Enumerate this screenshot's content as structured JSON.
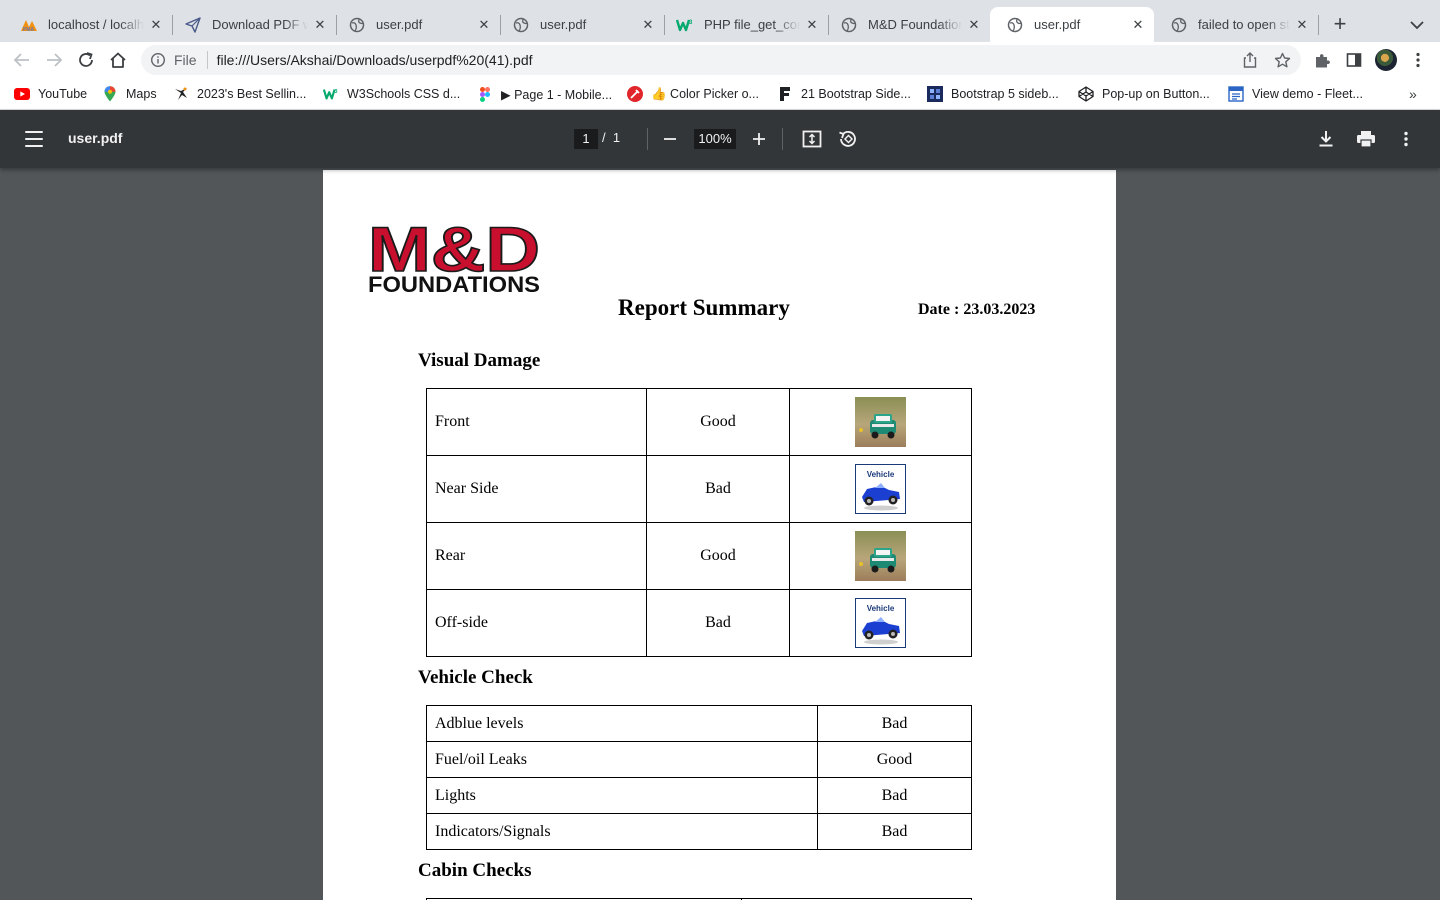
{
  "tabs": [
    {
      "title": "localhost / localhost",
      "icon": "phpmyadmin-icon",
      "active": false
    },
    {
      "title": "Download PDF with",
      "icon": "paper-plane-icon",
      "active": false
    },
    {
      "title": "user.pdf",
      "icon": "globe-icon",
      "active": false
    },
    {
      "title": "user.pdf",
      "icon": "globe-icon",
      "active": false
    },
    {
      "title": "PHP file_get_contents",
      "icon": "w3-icon",
      "active": false
    },
    {
      "title": "M&D Foundations",
      "icon": "globe-icon",
      "active": false
    },
    {
      "title": "user.pdf",
      "icon": "globe-icon",
      "active": true
    },
    {
      "title": "failed to open stream",
      "icon": "globe-icon",
      "active": false
    }
  ],
  "omnibox": {
    "scheme_label": "File",
    "url": "file:///Users/Akshai/Downloads/userpdf%20(41).pdf"
  },
  "bookmarks": [
    {
      "label": "YouTube",
      "icon": "youtube-icon"
    },
    {
      "label": "Maps",
      "icon": "maps-pin-icon"
    },
    {
      "label": "2023's Best Sellin...",
      "icon": "bird-icon"
    },
    {
      "label": "W3Schools CSS d...",
      "icon": "w3-icon"
    },
    {
      "label": "▶ Page 1 - Mobile...",
      "icon": "figma-icon"
    },
    {
      "label": "👍 Color Picker o...",
      "icon": "color-picker-icon"
    },
    {
      "label": "21 Bootstrap Side...",
      "icon": "f-icon"
    },
    {
      "label": "Bootstrap 5 sideb...",
      "icon": "grid-icon"
    },
    {
      "label": "Pop-up on Button...",
      "icon": "codepen-icon"
    },
    {
      "label": "View demo - Fleet...",
      "icon": "page-icon"
    }
  ],
  "pdf_viewer": {
    "file_name": "user.pdf",
    "current_page": "1",
    "page_total": "/  1",
    "zoom": "100%"
  },
  "report": {
    "logo_top": "M&D",
    "logo_bottom": "FOUNDATIONS",
    "title": "Report Summary",
    "date": "Date : 23.03.2023",
    "sections": {
      "visual_damage": "Visual Damage",
      "vehicle_check": "Vehicle Check",
      "cabin_checks": "Cabin Checks"
    },
    "visual_damage_rows": [
      {
        "area": "Front",
        "status": "Good",
        "photo": "green-car-photo"
      },
      {
        "area": "Near Side",
        "status": "Bad",
        "photo": "blue-car-photo"
      },
      {
        "area": "Rear",
        "status": "Good",
        "photo": "green-car-photo"
      },
      {
        "area": "Off-side",
        "status": "Bad",
        "photo": "blue-car-photo"
      }
    ],
    "photo_caption": "Vehicle",
    "vehicle_check_rows": [
      {
        "item": "Adblue levels",
        "status": "Bad"
      },
      {
        "item": "Fuel/oil Leaks",
        "status": "Good"
      },
      {
        "item": "Lights",
        "status": "Bad"
      },
      {
        "item": "Indicators/Signals",
        "status": "Bad"
      }
    ]
  },
  "colors": {
    "logo_red": "#c8102e",
    "pdf_toolbar": "#323639",
    "viewer_bg": "#525659",
    "tabstrip": "#dee1e6"
  }
}
